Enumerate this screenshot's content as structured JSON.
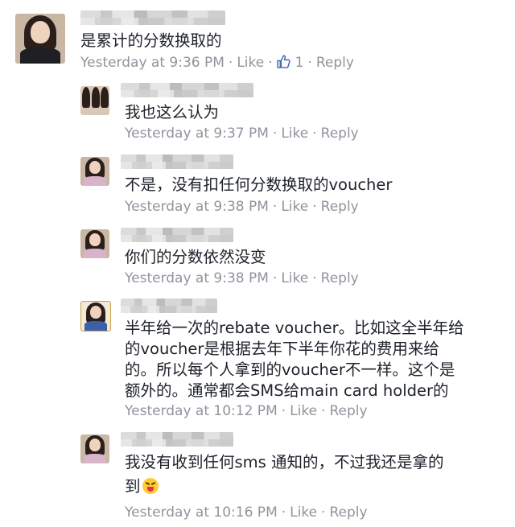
{
  "comments": [
    {
      "text": "是累计的分数换取的",
      "time": "Yesterday at 9:36 PM",
      "like_label": "Like",
      "like_count": "1",
      "reply_label": "Reply"
    },
    {
      "text": "我也这么认为",
      "time": "Yesterday at 9:37 PM",
      "like_label": "Like",
      "reply_label": "Reply"
    },
    {
      "text": "不是，没有扣任何分数换取的voucher",
      "time": "Yesterday at 9:38 PM",
      "like_label": "Like",
      "reply_label": "Reply"
    },
    {
      "text": "你们的分数依然没变",
      "time": "Yesterday at 9:38 PM",
      "like_label": "Like",
      "reply_label": "Reply"
    },
    {
      "lines": [
        "半年给一次的rebate voucher。比如这全半年给",
        "的voucher是根据去年下半年你花的费用来给",
        "的。所以每个人拿到的voucher不一样。这个是",
        "额外的。通常都会SMS给main card holder的"
      ],
      "time": "Yesterday at 10:12 PM",
      "like_label": "Like",
      "reply_label": "Reply"
    },
    {
      "lines": [
        "我没有收到任何sms 通知的，不过我还是拿的",
        "到"
      ],
      "emoji": "tongue-out-emoji",
      "time": "Yesterday at 10:16 PM",
      "like_label": "Like",
      "reply_label": "Reply"
    }
  ],
  "colors": {
    "text": "#1d2129",
    "meta": "#90949c",
    "like_blue": "#4267b2"
  },
  "icons": [
    "like-thumb-icon",
    "tongue-out-emoji"
  ]
}
